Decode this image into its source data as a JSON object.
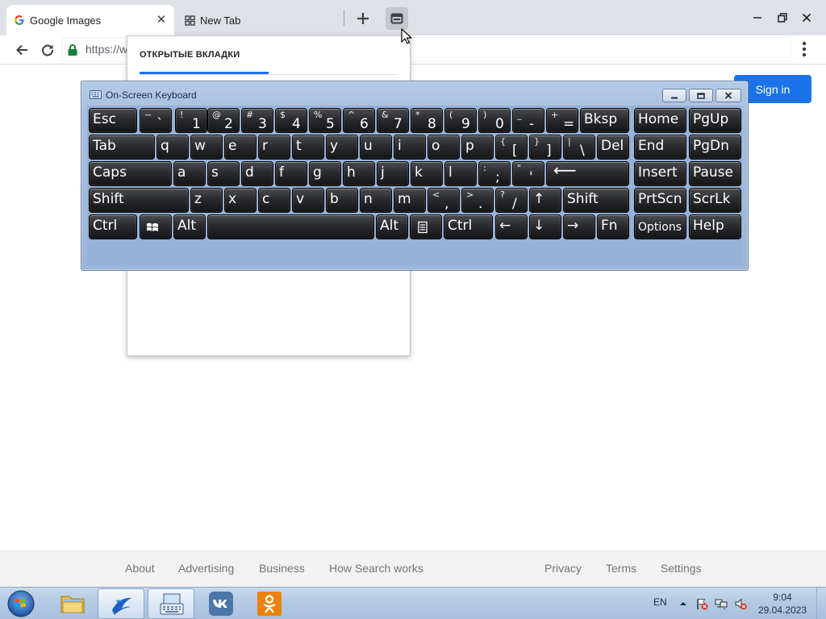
{
  "browser": {
    "tabs": [
      {
        "title": "Google Images",
        "icon": "google-g-icon",
        "active": true
      },
      {
        "title": "New Tab",
        "icon": "grid-icon",
        "active": false
      }
    ],
    "url": "https://w"
  },
  "tab_search_popup": {
    "heading": "ОТКРЫТЫЕ ВКЛАДКИ"
  },
  "page": {
    "signin_label": "Sign in",
    "footer_links": [
      "About",
      "Advertising",
      "Business",
      "How Search works",
      "Privacy",
      "Terms",
      "Settings"
    ]
  },
  "osk": {
    "title": "On-Screen Keyboard",
    "rows": [
      [
        {
          "label": "Esc"
        },
        {
          "shift": "~",
          "primary": "`"
        },
        {
          "shift": "!",
          "primary": "1"
        },
        {
          "shift": "@",
          "primary": "2"
        },
        {
          "shift": "#",
          "primary": "3"
        },
        {
          "shift": "$",
          "primary": "4"
        },
        {
          "shift": "%",
          "primary": "5"
        },
        {
          "shift": "^",
          "primary": "6"
        },
        {
          "shift": "&",
          "primary": "7"
        },
        {
          "shift": "*",
          "primary": "8"
        },
        {
          "shift": "(",
          "primary": "9"
        },
        {
          "shift": ")",
          "primary": "0"
        },
        {
          "shift": "_",
          "primary": "-"
        },
        {
          "shift": "+",
          "primary": "="
        },
        {
          "label": "Bksp"
        },
        {
          "label": "Home"
        },
        {
          "label": "PgUp"
        }
      ],
      [
        {
          "label": "Tab"
        },
        {
          "label": "q"
        },
        {
          "label": "w"
        },
        {
          "label": "e"
        },
        {
          "label": "r"
        },
        {
          "label": "t"
        },
        {
          "label": "y"
        },
        {
          "label": "u"
        },
        {
          "label": "i"
        },
        {
          "label": "o"
        },
        {
          "label": "p"
        },
        {
          "shift": "{",
          "primary": "["
        },
        {
          "shift": "}",
          "primary": "]"
        },
        {
          "shift": "|",
          "primary": "\\"
        },
        {
          "label": "Del"
        },
        {
          "label": "End"
        },
        {
          "label": "PgDn"
        }
      ],
      [
        {
          "label": "Caps"
        },
        {
          "label": "a"
        },
        {
          "label": "s"
        },
        {
          "label": "d"
        },
        {
          "label": "f"
        },
        {
          "label": "g"
        },
        {
          "label": "h"
        },
        {
          "label": "j"
        },
        {
          "label": "k"
        },
        {
          "label": "l"
        },
        {
          "shift": ":",
          "primary": ";"
        },
        {
          "shift": "\"",
          "primary": "'"
        },
        {
          "label": "⟵",
          "icon": "enter-arrow-icon"
        },
        {
          "label": "Insert"
        },
        {
          "label": "Pause"
        }
      ],
      [
        {
          "label": "Shift"
        },
        {
          "label": "z"
        },
        {
          "label": "x"
        },
        {
          "label": "c"
        },
        {
          "label": "v"
        },
        {
          "label": "b"
        },
        {
          "label": "n"
        },
        {
          "label": "m"
        },
        {
          "shift": "<",
          "primary": ","
        },
        {
          "shift": ">",
          "primary": "."
        },
        {
          "shift": "?",
          "primary": "/"
        },
        {
          "label": "↑"
        },
        {
          "label": "Shift"
        },
        {
          "label": "PrtScn"
        },
        {
          "label": "ScrLk"
        }
      ],
      [
        {
          "label": "Ctrl"
        },
        {
          "label": "",
          "icon": "windows-logo-icon"
        },
        {
          "label": "Alt"
        },
        {
          "label": "",
          "icon": "spacebar"
        },
        {
          "label": "Alt"
        },
        {
          "label": "",
          "icon": "context-menu-icon"
        },
        {
          "label": "Ctrl"
        },
        {
          "label": "←"
        },
        {
          "label": "↓"
        },
        {
          "label": "→"
        },
        {
          "label": "Fn"
        },
        {
          "label": "Options"
        },
        {
          "label": "Help"
        }
      ]
    ]
  },
  "taskbar": {
    "apps": [
      {
        "name": "file-explorer",
        "icon": "folder-icon",
        "active": false
      },
      {
        "name": "app-blue-swoosh",
        "icon": "swoosh-icon",
        "active": true
      },
      {
        "name": "on-screen-keyboard",
        "icon": "keyboard-icon",
        "active": true
      },
      {
        "name": "vk",
        "icon": "vk-icon",
        "active": false
      },
      {
        "name": "odnoklassniki",
        "icon": "ok-icon",
        "active": false
      }
    ],
    "tray": {
      "language": "EN",
      "icons": [
        "show-hidden-arrow-icon",
        "action-center-flag-icon",
        "network-icon",
        "volume-muted-icon"
      ],
      "time": "9:04",
      "date": "29.04.2023"
    }
  }
}
